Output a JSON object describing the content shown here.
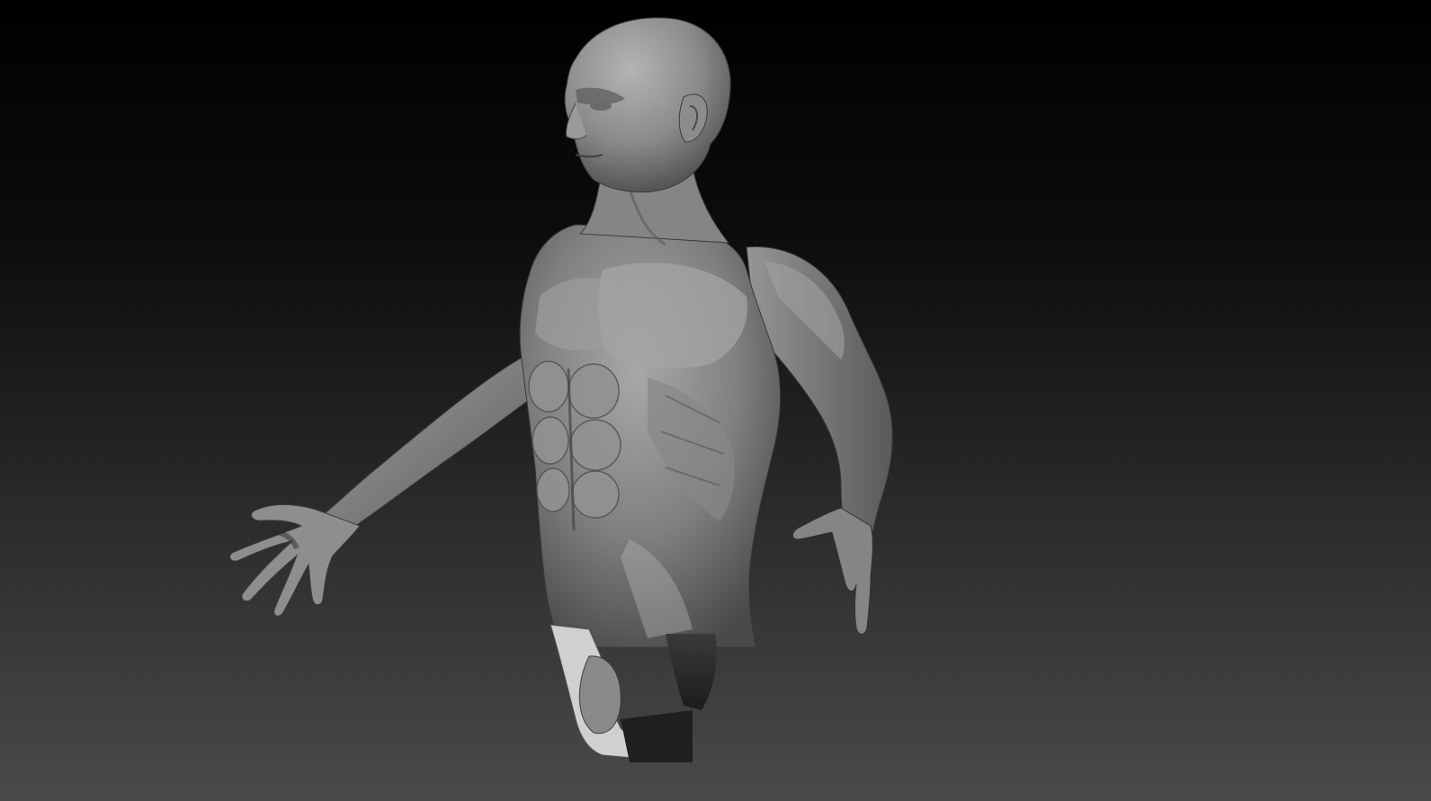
{
  "viewport": {
    "background_top_color": "#000000",
    "background_bottom_color": "#4a4a4a",
    "material_base_color": "#7a7a7a",
    "material_highlight_color": "#b8b8b8",
    "material_shadow_color": "#2e2e2e"
  },
  "model": {
    "subject": "male-torso-sculpt",
    "parts": [
      "head",
      "ear",
      "neck",
      "chest",
      "abdomen",
      "left-arm",
      "right-arm",
      "left-hand",
      "right-hand",
      "pelvis-cutoff"
    ]
  }
}
